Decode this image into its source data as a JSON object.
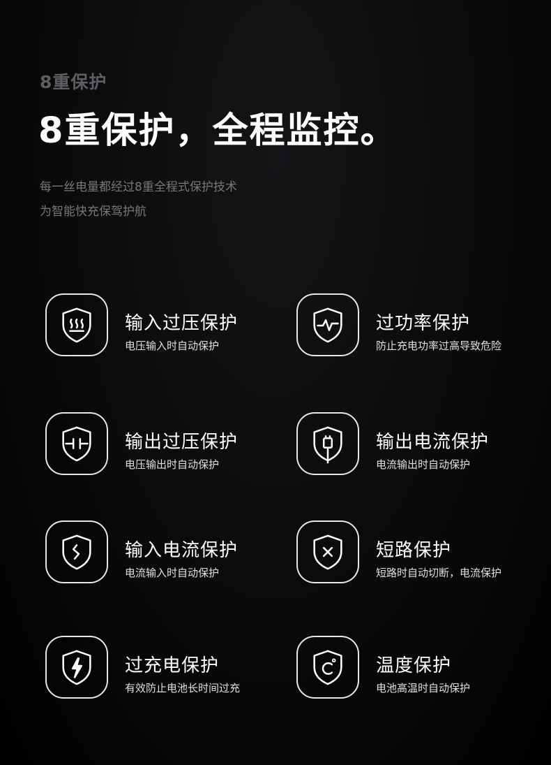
{
  "header": {
    "eyebrow": "8重保护",
    "headline": "8重保护，全程监控。",
    "desc_line1": "每一丝电量都经过8重全程式保护技术",
    "desc_line2": "为智能快充保驾护航"
  },
  "features": [
    {
      "title": "输入过压保护",
      "subtitle": "电压输入时自动保护",
      "icon": "heat-shield-icon"
    },
    {
      "title": "过功率保护",
      "subtitle": "防止充电功率过高导致危险",
      "icon": "pulse-shield-icon"
    },
    {
      "title": "输出过压保护",
      "subtitle": "电压输出时自动保护",
      "icon": "capacitor-shield-icon"
    },
    {
      "title": "输出电流保护",
      "subtitle": "电流输出时自动保护",
      "icon": "plug-shield-icon"
    },
    {
      "title": "输入电流保护",
      "subtitle": "电流输入时自动保护",
      "icon": "wave-shield-icon"
    },
    {
      "title": "短路保护",
      "subtitle": "短路时自动切断，电流保护",
      "icon": "x-shield-icon"
    },
    {
      "title": "过充电保护",
      "subtitle": "有效防止电池长时间过充",
      "icon": "bolt-shield-icon"
    },
    {
      "title": "温度保护",
      "subtitle": "电池高温时自动保护",
      "icon": "celsius-shield-icon"
    }
  ]
}
